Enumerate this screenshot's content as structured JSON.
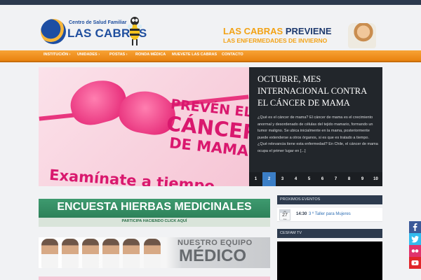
{
  "header": {
    "logo_line1": "Centro de Salud Familiar",
    "logo_line2": "LAS CABRAS",
    "banner_word1": "LAS CABRAS",
    "banner_word2": "PREVIENE",
    "banner_line2": "LAS ENFERMEDADES DE INVIERNO"
  },
  "nav": {
    "items": [
      {
        "label": "INSTITUCIÓN ›"
      },
      {
        "label": "UNIDADES ›"
      },
      {
        "label": "POSTAS ›"
      },
      {
        "label": "RONDA MÉDICA"
      },
      {
        "label": "MUEVETE LAS CABRAS"
      },
      {
        "label": "CONTACTO"
      }
    ]
  },
  "slider": {
    "image_lines": [
      "PREVÉN EL",
      "CÁNCER",
      "DE MAMA",
      "Examínate a tiempo"
    ],
    "title": "OCTUBRE, MES INTERNACIONAL CONTRA EL CÁNCER DE MAMA",
    "excerpt": "¿Qué es el cáncer de mama?  El cáncer de mama es el crecimiento anormal y desordenado de células del tejido mamario, formando un tumor maligno. Se ubica inicialmente en la mama, posteriormente puede extenderse a otros órganos, si es que es tratado a tiempo.  ¿Qué relevancia tiene esta enfermedad?  En Chile, el cáncer de mama ocupa el primer lugar en [...]",
    "pages": [
      "1",
      "2",
      "3",
      "4",
      "5",
      "6",
      "7",
      "8",
      "9",
      "10"
    ],
    "active_page": "2"
  },
  "encuesta": {
    "title": "ENCUESTA HIERBAS MEDICINALES",
    "subtitle": "PARTICIPA HACIENDO CLICK AQUÍ"
  },
  "equipo": {
    "line1": "NUESTRO EQUIPO",
    "line2": "MÉDICO"
  },
  "events": {
    "heading": "PROXIMOS EVENTOS",
    "items": [
      {
        "cal_top": "dic",
        "day": "27",
        "month": "Jue",
        "time": "14:30",
        "name": "3 º Taller para Mujeres"
      }
    ]
  },
  "tv": {
    "heading": "CESFAM TV"
  },
  "social": {
    "icons": [
      "facebook-icon",
      "twitter-icon",
      "flickr-icon",
      "youtube-icon"
    ],
    "colors": {
      "facebook": "#3b5998",
      "twitter": "#33bbee",
      "flickr": "#e0336d",
      "youtube": "#e1262a"
    }
  },
  "colors": {
    "nav_orange": "#f08e1f",
    "dark_panel": "#22262b",
    "active_page": "#3b7ec6",
    "encuesta_green": "#2f8a5e",
    "brand_blue": "#1f4e9e"
  }
}
